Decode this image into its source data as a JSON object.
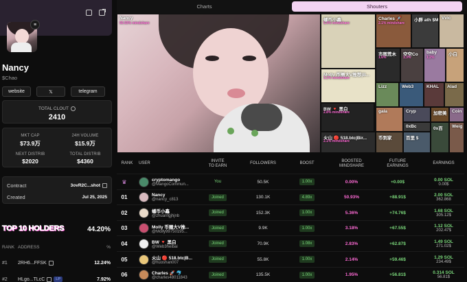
{
  "profile": {
    "name": "Nancy",
    "ticker": "$Chao",
    "avatar_badge": "≡",
    "links": [
      "website",
      "𝕏",
      "telegram"
    ]
  },
  "clout": {
    "label": "TOTAL CLOUT",
    "value": "2410"
  },
  "stats": {
    "mkt_cap": {
      "label": "MKT CAP",
      "value": "$73.9万"
    },
    "volume": {
      "label": "24H VOLUME",
      "value": "$15.9万"
    },
    "next_distrib": {
      "label": "NEXT DISTRIB",
      "value": "$2020"
    },
    "total_distrib": {
      "label": "TOTAL DISTRIB",
      "value": "$4360"
    }
  },
  "contract": {
    "label": "Contract",
    "value": "3ovR2C...shot"
  },
  "created": {
    "label": "Created",
    "value": "Jul 25, 2025"
  },
  "holders": {
    "title": "TOP 10 HOLDERS",
    "pct": "44.20%",
    "col_rank": "RANK",
    "col_address": "ADDRESS",
    "col_pct": "%",
    "rows": [
      {
        "rank": "#1",
        "address": "2RH6...FFSK",
        "pct": "12.24%",
        "tag": ""
      },
      {
        "rank": "#2",
        "address": "HLgo...TLcC",
        "pct": "7.92%",
        "tag": "LP"
      }
    ]
  },
  "tabs": {
    "charts": "Charts",
    "shouters": "Shouters"
  },
  "treemap": [
    {
      "name": "Nancy",
      "pct": "50.93% mindshare"
    },
    {
      "name": "蟠币小鑫",
      "pct": "5.4% mindshare"
    },
    {
      "name": "Charles 🚀",
      "pct": "2.1% mindshare"
    },
    {
      "name": "小胖 ath $M",
      "pct": ""
    },
    {
      "name": "Vvic",
      "pct": ""
    },
    {
      "name": "市图荒木",
      "pct": "1.6%"
    },
    {
      "name": "空空Co",
      "pct": "1.3%"
    },
    {
      "name": "baby",
      "pct": "1.2%"
    },
    {
      "name": "小白",
      "pct": ""
    },
    {
      "name": "Molly 币圈大V推荐|B...",
      "pct": "3.2% mindshare"
    },
    {
      "name": "Lizz",
      "pct": ""
    },
    {
      "name": "Web3",
      "pct": ""
    },
    {
      "name": "KHAL",
      "pct": ""
    },
    {
      "name": "Alad",
      "pct": ""
    },
    {
      "name": "BW 🔻 黑白",
      "pct": "2.8% mindshare"
    },
    {
      "name": "gala",
      "pct": ""
    },
    {
      "name": "Cryp",
      "pct": ""
    },
    {
      "name": "加密美",
      "pct": ""
    },
    {
      "name": "Coin",
      "pct": ""
    },
    {
      "name": "0xBc",
      "pct": ""
    },
    {
      "name": "火山 🔴 518.btc|Bir...",
      "pct": "2.1% mindshare"
    },
    {
      "name": "币到家",
      "pct": ""
    },
    {
      "name": "百里 $",
      "pct": ""
    },
    {
      "name": "0x百",
      "pct": ""
    },
    {
      "name": "Weig",
      "pct": ""
    }
  ],
  "table": {
    "headers": {
      "rank": "RANK",
      "user": "USER",
      "invite": "INVITE\nTO EARN",
      "followers": "FOLLOWERS",
      "boost": "BOOST",
      "mindshare": "BOOSTED\nMINDSHARE",
      "future": "FUTURE\nEARNINGS",
      "earnings": "EARNINGS"
    },
    "rows": [
      {
        "rank": "♛",
        "name": "cryptomango",
        "handle": "@MangoCommun...",
        "invite": "You",
        "followers": "50.5K",
        "boost": "1.00x",
        "mind": "0.00%",
        "future": "+0.00$",
        "sol": "0.00 SOL",
        "usd": "0.00$",
        "av": "#4a8a6a"
      },
      {
        "rank": "01",
        "name": "Nancy",
        "handle": "@nancy_c813",
        "invite": "Joined",
        "followers": "130.1K",
        "boost": "4.89x",
        "mind": "50.93%",
        "future": "+88.91$",
        "sol": "2.00 SOL",
        "usd": "362.868",
        "av": "#d7b9be"
      },
      {
        "rank": "02",
        "name": "蟠币小鑫",
        "handle": "@zhuanfgjhjnb",
        "invite": "Joined",
        "followers": "152.3K",
        "boost": "1.00x",
        "mind": "5.36%",
        "future": "+74.76$",
        "sol": "1.68 SOL",
        "usd": "305.12$",
        "av": "#e8d9c8"
      },
      {
        "rank": "03",
        "name": "Molly 币圈大V推...",
        "handle": "@Molly99750195...",
        "invite": "Joined",
        "followers": "9.9K",
        "boost": "1.00x",
        "mind": "3.18%",
        "future": "+67.55$",
        "sol": "1.12 SOL",
        "usd": "202.47$",
        "av": "#c94f70"
      },
      {
        "rank": "04",
        "name": "BW 🔻 黑白",
        "handle": "@Web3heibai",
        "invite": "Joined",
        "followers": "70.9K",
        "boost": "1.08x",
        "mind": "2.83%",
        "future": "+62.87$",
        "sol": "1.49 SOL",
        "usd": "271.02$",
        "av": "#eeeeee"
      },
      {
        "rank": "05",
        "name": "火山 🔴 518.btc|B...",
        "handle": "@huoshan007",
        "invite": "Joined",
        "followers": "55.8K",
        "boost": "1.00x",
        "mind": "2.14%",
        "future": "+59.46$",
        "sol": "1.29 SOL",
        "usd": "234.49$",
        "av": "#e9c77a"
      },
      {
        "rank": "06",
        "name": "Charles 🚀 🐬",
        "handle": "@charles48011843",
        "invite": "Joined",
        "followers": "135.5K",
        "boost": "1.00x",
        "mind": "1.95%",
        "future": "+56.81$",
        "sol": "0.314 SOL",
        "usd": "56.81$",
        "av": "#c68a5a"
      }
    ]
  }
}
